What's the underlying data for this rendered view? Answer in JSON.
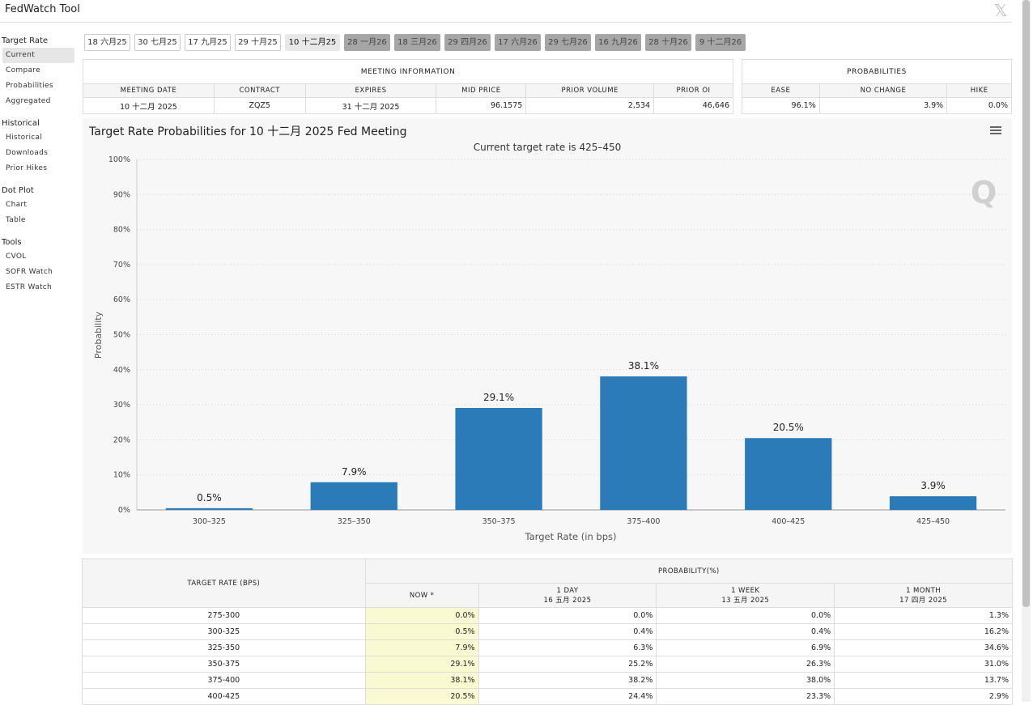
{
  "header": {
    "title": "FedWatch Tool",
    "close_glyph": "𝕏"
  },
  "sidebar": {
    "sections": [
      {
        "title": "Target Rate",
        "items": [
          "Current",
          "Compare",
          "Probabilities",
          "Aggregated"
        ]
      },
      {
        "title": "Historical",
        "items": [
          "Historical",
          "Downloads",
          "Prior Hikes"
        ]
      },
      {
        "title": "Dot Plot",
        "items": [
          "Chart",
          "Table"
        ]
      },
      {
        "title": "Tools",
        "items": [
          "CVOL",
          "SOFR Watch",
          "ESTR Watch"
        ]
      }
    ],
    "active": "Current"
  },
  "tabs": [
    "18 六月25",
    "30 七月25",
    "17 九月25",
    "29 十月25",
    "10 十二月25",
    "28 一月26",
    "18 三月26",
    "29 四月26",
    "17 六月26",
    "29 七月26",
    "16 九月26",
    "28 十月26",
    "9 十二月26"
  ],
  "selected_tab": "10 十二月25",
  "meeting_info": {
    "title": "MEETING INFORMATION",
    "headers": [
      "MEETING DATE",
      "CONTRACT",
      "EXPIRES",
      "MID PRICE",
      "PRIOR VOLUME",
      "PRIOR OI"
    ],
    "values": [
      "10 十二月 2025",
      "ZQZ5",
      "31 十二月 2025",
      "96.1575",
      "2,534",
      "46,646"
    ]
  },
  "probabilities": {
    "title": "PROBABILITIES",
    "headers": [
      "EASE",
      "NO CHANGE",
      "HIKE"
    ],
    "values": [
      "96.1%",
      "3.9%",
      "0.0%"
    ]
  },
  "chart": {
    "title": "Target Rate Probabilities for 10 十二月 2025 Fed Meeting",
    "subtitle": "Current target rate is 425–450",
    "menu_icon": "hamburger-menu-icon",
    "watermark": "Q",
    "bar_color": "#2b7bb9"
  },
  "chart_data": {
    "type": "bar",
    "title": "Target Rate Probabilities for 10 十二月 2025 Fed Meeting",
    "subtitle": "Current target rate is 425–450",
    "xlabel": "Target Rate (in bps)",
    "ylabel": "Probability",
    "categories": [
      "300–325",
      "325–350",
      "350–375",
      "375–400",
      "400–425",
      "425–450"
    ],
    "values": [
      0.5,
      7.9,
      29.1,
      38.1,
      20.5,
      3.9
    ],
    "data_labels": [
      "0.5%",
      "7.9%",
      "29.1%",
      "38.1%",
      "20.5%",
      "3.9%"
    ],
    "ylim": [
      0,
      100
    ],
    "yticks": [
      "0%",
      "10%",
      "20%",
      "30%",
      "40%",
      "50%",
      "60%",
      "70%",
      "80%",
      "90%",
      "100%"
    ],
    "grid": true,
    "legend": "none"
  },
  "lower_table": {
    "col1_header": "TARGET RATE (BPS)",
    "group_header": "PROBABILITY(%)",
    "sub_headers": [
      {
        "line1": "NOW *",
        "line2": ""
      },
      {
        "line1": "1 DAY",
        "line2": "16 五月 2025"
      },
      {
        "line1": "1 WEEK",
        "line2": "13 五月 2025"
      },
      {
        "line1": "1 MONTH",
        "line2": "17 四月 2025"
      }
    ],
    "rows": [
      [
        "275-300",
        "0.0%",
        "0.0%",
        "0.0%",
        "1.3%"
      ],
      [
        "300-325",
        "0.5%",
        "0.4%",
        "0.4%",
        "16.2%"
      ],
      [
        "325-350",
        "7.9%",
        "6.3%",
        "6.9%",
        "34.6%"
      ],
      [
        "350-375",
        "29.1%",
        "25.2%",
        "26.3%",
        "31.0%"
      ],
      [
        "375-400",
        "38.1%",
        "38.2%",
        "38.0%",
        "13.7%"
      ],
      [
        "400-425",
        "20.5%",
        "24.4%",
        "23.3%",
        "2.9%"
      ]
    ]
  }
}
